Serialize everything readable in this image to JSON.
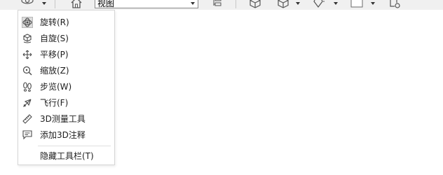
{
  "toolbar": {
    "view_select": {
      "value": "视图"
    },
    "icons": [
      "orbit-icon",
      "home-icon",
      "view-cube-icon",
      "box-icon",
      "box-wire-icon",
      "lightbulb-icon",
      "color-swatch-icon",
      "settings-doc-icon"
    ]
  },
  "menu": {
    "items": [
      {
        "label": "旋转(R)",
        "icon": "orbit-icon",
        "checked": true
      },
      {
        "label": "自旋(S)",
        "icon": "spin-icon",
        "checked": false
      },
      {
        "label": "平移(P)",
        "icon": "pan-icon",
        "checked": false
      },
      {
        "label": "缩放(Z)",
        "icon": "zoom-icon",
        "checked": false
      },
      {
        "label": "步览(W)",
        "icon": "walk-icon",
        "checked": false
      },
      {
        "label": "飞行(F)",
        "icon": "fly-icon",
        "checked": false
      },
      {
        "label": "3D测量工具",
        "icon": "ruler-icon",
        "checked": false
      },
      {
        "label": "添加3D注释",
        "icon": "comment-icon",
        "checked": false
      }
    ],
    "hide_toolbar": {
      "label": "隐藏工具栏(T)"
    }
  }
}
